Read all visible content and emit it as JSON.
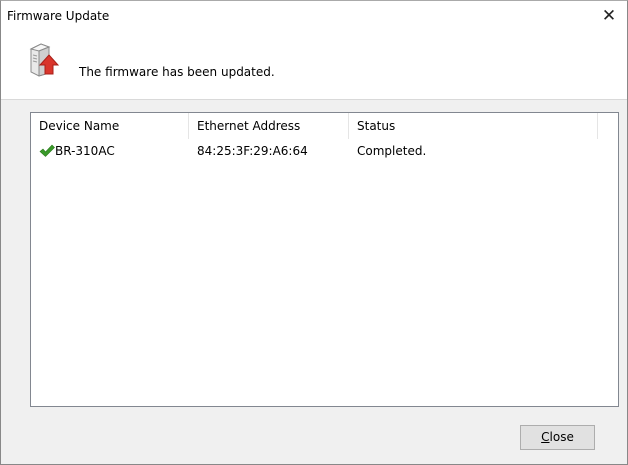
{
  "window": {
    "title": "Firmware Update",
    "close_glyph": "✕"
  },
  "header": {
    "icon": "firmware-update-icon",
    "message": "The firmware has been updated."
  },
  "table": {
    "columns": [
      "Device Name",
      "Ethernet Address",
      "Status"
    ],
    "rows": [
      {
        "status_icon": "check-icon",
        "device_name": "BR-310AC",
        "ethernet_address": "84:25:3F:29:A6:64",
        "status": "Completed."
      }
    ]
  },
  "footer": {
    "close_label_mnemonic": "C",
    "close_label_rest": "lose"
  },
  "colors": {
    "check_green": "#3a9a2a",
    "arrow_red": "#d9352b"
  }
}
